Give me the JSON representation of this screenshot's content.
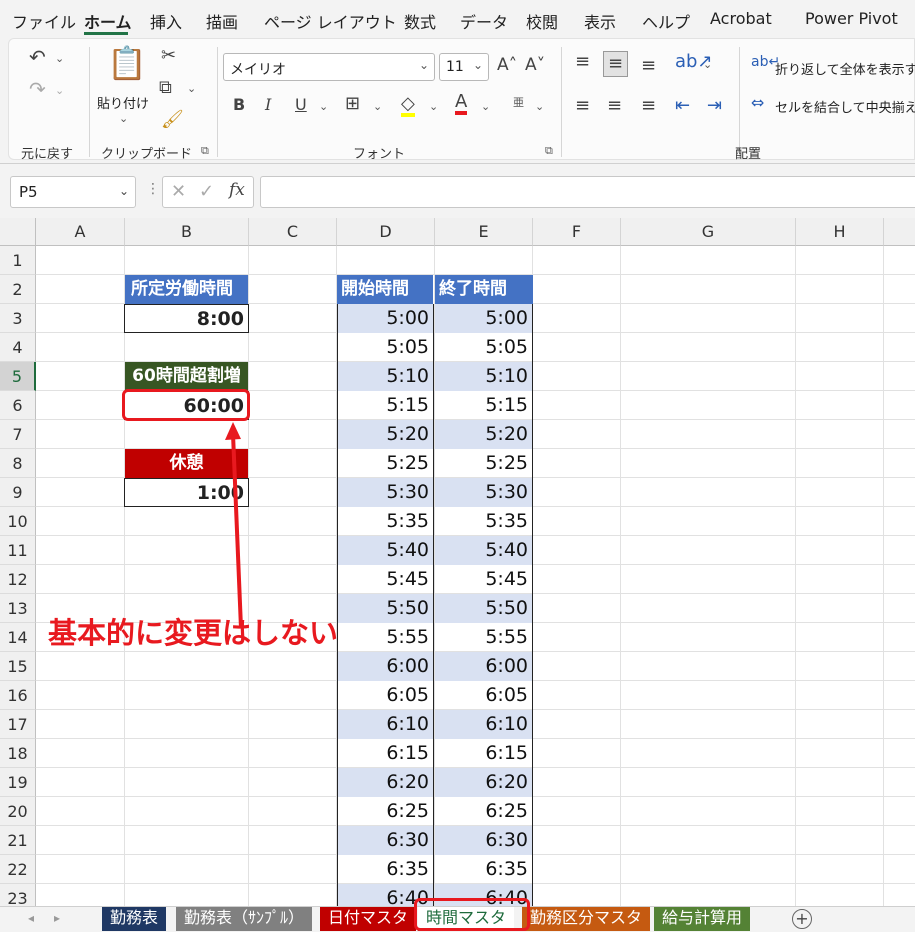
{
  "menu": {
    "tabs": [
      "ファイル",
      "ホーム",
      "挿入",
      "描画",
      "ページ レイアウト",
      "数式",
      "データ",
      "校閲",
      "表示",
      "ヘルプ",
      "Acrobat",
      "Power Pivot"
    ],
    "active_index": 1
  },
  "ribbon": {
    "undo_group_label": "元に戻す",
    "clipboard_label": "クリップボード",
    "paste_label": "貼り付け",
    "font_group_label": "フォント",
    "font_name": "メイリオ",
    "font_size": "11",
    "bold": "B",
    "italic": "I",
    "underline": "U",
    "align_group_label": "配置",
    "wrap_text_label": "折り返して全体を表示す",
    "merge_center_label": "セルを結合して中央揃え",
    "phonetic_label": "亜"
  },
  "formula_bar": {
    "name_box": "P5",
    "fx": "fx",
    "formula": ""
  },
  "columns": [
    "A",
    "B",
    "C",
    "D",
    "E",
    "F",
    "G",
    "H"
  ],
  "rows": [
    "1",
    "2",
    "3",
    "4",
    "5",
    "6",
    "7",
    "8",
    "9",
    "10",
    "11",
    "12",
    "13",
    "14",
    "15",
    "16",
    "17",
    "18",
    "19",
    "20",
    "21",
    "22",
    "23"
  ],
  "selected_row": "5",
  "sheet": {
    "scheduled_hours_header": "所定労働時間",
    "scheduled_hours_value": "8:00",
    "overtime_header": "60時間超割増",
    "overtime_value": "60:00",
    "break_header": "休憩",
    "break_value": "1:00",
    "start_header": "開始時間",
    "end_header": "終了時間",
    "start_times": [
      "5:00",
      "5:05",
      "5:10",
      "5:15",
      "5:20",
      "5:25",
      "5:30",
      "5:35",
      "5:40",
      "5:45",
      "5:50",
      "5:55",
      "6:00",
      "6:05",
      "6:10",
      "6:15",
      "6:20",
      "6:25",
      "6:30",
      "6:35",
      "6:40"
    ],
    "end_times": [
      "5:00",
      "5:05",
      "5:10",
      "5:15",
      "5:20",
      "5:25",
      "5:30",
      "5:35",
      "5:40",
      "5:45",
      "5:50",
      "5:55",
      "6:00",
      "6:05",
      "6:10",
      "6:15",
      "6:20",
      "6:25",
      "6:30",
      "6:35",
      "6:40"
    ]
  },
  "annotation": {
    "text": "基本的に変更はしない",
    "color": "#e8191f"
  },
  "sheet_tabs": [
    {
      "label": "勤務表",
      "color": "#1f3864"
    },
    {
      "label": "勤務表（ｻﾝﾌﾟﾙ）",
      "color": "#808080"
    },
    {
      "label": "日付マスタ",
      "color": "#c00000"
    },
    {
      "label": "時間マスタ",
      "color": "#ffffff"
    },
    {
      "label": "勤務区分マスタ",
      "color": "#c55a11"
    },
    {
      "label": "給与計算用",
      "color": "#548235"
    }
  ],
  "active_sheet_index": 3
}
